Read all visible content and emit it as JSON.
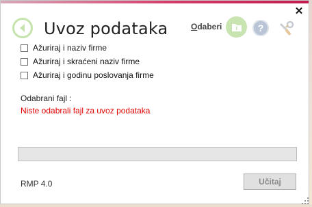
{
  "window": {
    "close_glyph": "✕"
  },
  "header": {
    "title": "Uvoz podataka",
    "choose_label_underlined": "O",
    "choose_label_rest": "daberi",
    "icons": {
      "back": "back-arrow-icon",
      "folder": "folder-icon",
      "help": "help-icon",
      "tools": "tools-icon"
    }
  },
  "options": [
    {
      "label": "Ažuriraj i naziv firme",
      "checked": false
    },
    {
      "label": "Ažuriraj i skraćeni naziv firme",
      "checked": false
    },
    {
      "label": "Ažuriraj i godinu poslovanja firme",
      "checked": false
    }
  ],
  "selected_file": {
    "label": "Odabrani fajl :",
    "value": "Niste odabrali fajl za uvoz podataka"
  },
  "progress": {
    "value": 0
  },
  "footer": {
    "version": "RMP 4.0",
    "load_label": "Učitaj",
    "load_enabled": false
  },
  "colors": {
    "accent_green": "#c6e3ad",
    "error_red": "#e00000",
    "title_strip": "#c41b4e"
  }
}
